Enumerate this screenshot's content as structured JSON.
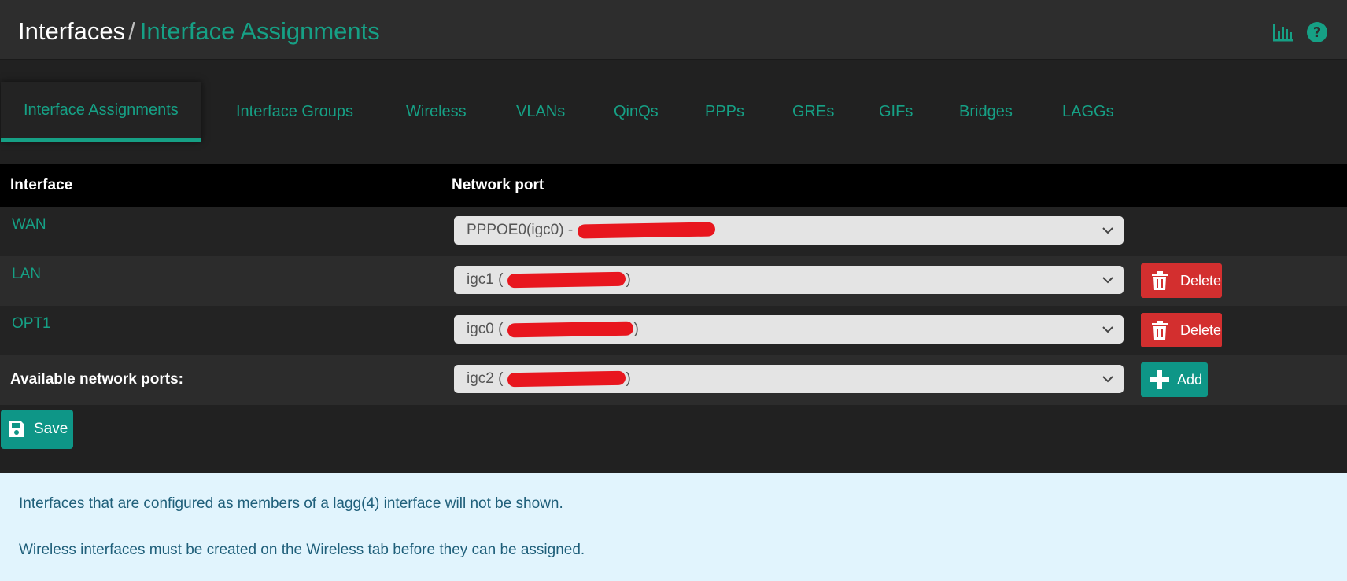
{
  "header": {
    "breadcrumb_root": "Interfaces",
    "breadcrumb_separator": "/",
    "breadcrumb_current": "Interface Assignments",
    "icons": [
      "chart-bars-icon",
      "help-question-icon"
    ]
  },
  "tabs": [
    {
      "label": "Interface Assignments",
      "active": true
    },
    {
      "label": "Interface Groups"
    },
    {
      "label": "Wireless"
    },
    {
      "label": "VLANs"
    },
    {
      "label": "QinQs"
    },
    {
      "label": "PPPs"
    },
    {
      "label": "GREs"
    },
    {
      "label": "GIFs"
    },
    {
      "label": "Bridges"
    },
    {
      "label": "LAGGs"
    }
  ],
  "table": {
    "col_interface": "Interface",
    "col_network_port": "Network port",
    "rows": [
      {
        "interface": "WAN",
        "port": "PPPOE0(igc0) -"
      },
      {
        "interface": "LAN",
        "port": "igc1 (",
        "port_suffix": ")",
        "action": "Delete"
      },
      {
        "interface": "OPT1",
        "port": "igc0 (",
        "port_suffix": ")",
        "action": "Delete"
      }
    ],
    "available_label": "Available network ports:",
    "available_port": "igc2 (",
    "available_port_suffix": ")",
    "add_label": "Add"
  },
  "save_label": "Save",
  "info": {
    "line1": "Interfaces that are configured as members of a lagg(4) interface will not be shown.",
    "line2": "Wireless interfaces must be created on the Wireless tab before they can be assigned."
  },
  "colors": {
    "accent": "#16a085",
    "danger": "#d32f2f",
    "success": "#0e9687",
    "redaction": "#e8161e",
    "info_bg": "#e1f4fd"
  }
}
